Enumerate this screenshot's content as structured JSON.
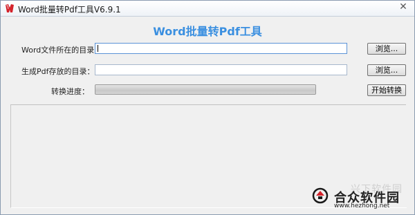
{
  "window": {
    "title": "Word批量转Pdf工具V6.9.1",
    "close_glyph": "✕"
  },
  "heading": "Word批量转Pdf工具",
  "form": {
    "source_label": "Word文件所在的目录：",
    "source_value": "",
    "output_label": "生成Pdf存放的目录：",
    "output_value": "",
    "browse_label": "浏览...",
    "progress_label": "转换进度：",
    "progress_value": 0,
    "start_label": "开始转换"
  },
  "watermark": {
    "shadow_text": "兴下软件园",
    "name": "合众软件园",
    "url": "www.hezhong.net"
  },
  "colors": {
    "heading": "#3a8fe0",
    "accent_red": "#d4232b"
  }
}
